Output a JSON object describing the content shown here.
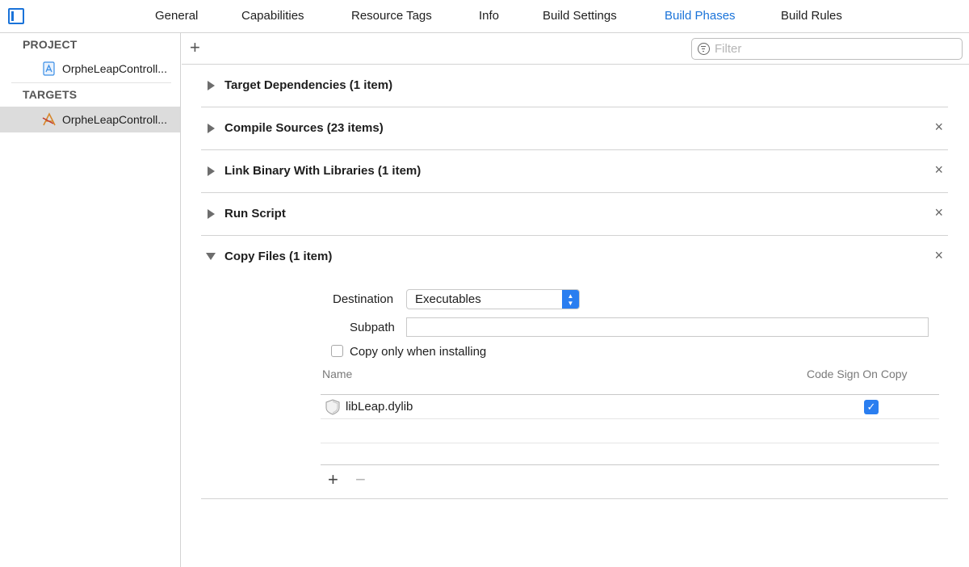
{
  "tabs": [
    {
      "label": "General",
      "active": false
    },
    {
      "label": "Capabilities",
      "active": false
    },
    {
      "label": "Resource Tags",
      "active": false
    },
    {
      "label": "Info",
      "active": false
    },
    {
      "label": "Build Settings",
      "active": false
    },
    {
      "label": "Build Phases",
      "active": true
    },
    {
      "label": "Build Rules",
      "active": false
    }
  ],
  "sidebar": {
    "project_header": "PROJECT",
    "project_item": {
      "label": "OrpheLeapControll...",
      "icon": "xcode-project-icon"
    },
    "targets_header": "TARGETS",
    "target_item": {
      "label": "OrpheLeapControll...",
      "icon": "app-target-icon",
      "selected": true
    }
  },
  "toolbar": {
    "add_label": "+",
    "filter_placeholder": "Filter",
    "filter_icon": "filter-icon"
  },
  "phases": [
    {
      "title": "Target Dependencies (1 item)",
      "expanded": false,
      "deletable": false
    },
    {
      "title": "Compile Sources (23 items)",
      "expanded": false,
      "deletable": true
    },
    {
      "title": "Link Binary With Libraries (1 item)",
      "expanded": false,
      "deletable": true
    },
    {
      "title": "Run Script",
      "expanded": false,
      "deletable": true
    },
    {
      "title": "Copy Files (1 item)",
      "expanded": true,
      "deletable": true
    }
  ],
  "delete_glyph": "×",
  "copy_files": {
    "destination_label": "Destination",
    "destination_value": "Executables",
    "subpath_label": "Subpath",
    "subpath_value": "",
    "install_only_label": "Copy only when installing",
    "install_only_checked": false,
    "columns": {
      "name": "Name",
      "code_sign": "Code Sign On Copy"
    },
    "files": [
      {
        "name": "libLeap.dylib",
        "icon": "dylib-file-icon",
        "code_sign": true
      }
    ],
    "add_label": "+",
    "remove_label": "−",
    "check_glyph": "✓"
  },
  "colors": {
    "accent": "#1a73d9",
    "checkbox": "#2a7ef0",
    "separator": "#d3d3d3"
  }
}
